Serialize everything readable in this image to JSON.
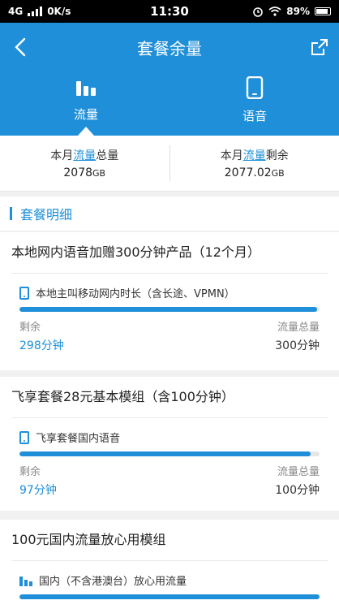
{
  "status": {
    "network": "4G",
    "speed": "0K/s",
    "time": "11:30",
    "battery": "89%"
  },
  "header": {
    "title": "套餐余量"
  },
  "tabs": [
    {
      "label": "流量"
    },
    {
      "label": "语音"
    }
  ],
  "summary": {
    "total": {
      "prefix": "本月",
      "highlight": "流量",
      "suffix": "总量",
      "value": "2078",
      "unit": "GB"
    },
    "remaining": {
      "prefix": "本月",
      "highlight": "流量",
      "suffix": "剩余",
      "value": "2077.02",
      "unit": "GB"
    }
  },
  "section": {
    "title": "套餐明细"
  },
  "packages": [
    {
      "title": "本地网内语音加赠300分钟产品（12个月）",
      "item": "本地主叫移动网内时长（含长途、VPMN）",
      "remain_label": "剩余",
      "remain_value": "298分钟",
      "total_label": "流量总量",
      "total_value": "300分钟",
      "progress": 0.993
    },
    {
      "title": "飞享套餐28元基本模组（含100分钟）",
      "item": "飞享套餐国内语音",
      "remain_label": "剩余",
      "remain_value": "97分钟",
      "total_label": "流量总量",
      "total_value": "100分钟",
      "progress": 0.97
    },
    {
      "title": "100元国内流量放心用模组",
      "item": "国内（不含港澳台）放心用流量",
      "progress": 1.0
    }
  ],
  "colors": {
    "accent": "#1e8fd8"
  }
}
